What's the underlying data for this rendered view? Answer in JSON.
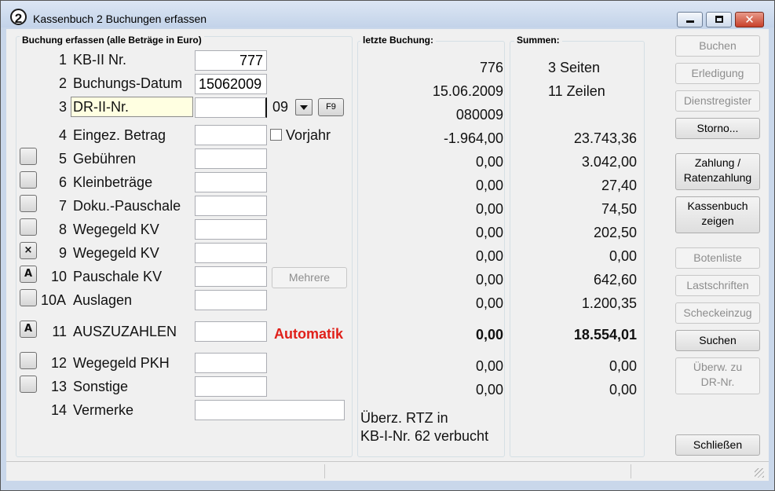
{
  "window": {
    "title": "Kassenbuch 2 Buchungen erfassen",
    "icon_text": "2"
  },
  "sections": {
    "entry": "Buchung erfassen (alle Beträge in Euro)",
    "last": "letzte Buchung:",
    "sums": "Summen:"
  },
  "rows": [
    {
      "num": "1",
      "label": "KB-II Nr.",
      "value": "777",
      "last": "776",
      "sum_text": "3 Seiten"
    },
    {
      "num": "2",
      "label": "Buchungs-Datum",
      "value": "15062009",
      "last": "15.06.2009",
      "sum_text": "11 Zeilen"
    },
    {
      "num": "3",
      "label": "DR-II-Nr.",
      "value": "",
      "suffix": "09",
      "f9": "F9",
      "last": "080009"
    },
    {
      "num": "4",
      "label": "Eingez. Betrag",
      "value": "",
      "checkbox": "Vorjahr",
      "last": "-1.964,00",
      "sum": "23.743,36"
    },
    {
      "num": "5",
      "label": "Gebühren",
      "value": "",
      "last": "0,00",
      "sum": "3.042,00"
    },
    {
      "num": "6",
      "label": "Kleinbeträge",
      "value": "",
      "last": "0,00",
      "sum": "27,40"
    },
    {
      "num": "7",
      "label": "Doku.-Pauschale",
      "value": "",
      "last": "0,00",
      "sum": "74,50"
    },
    {
      "num": "8",
      "label": "Wegegeld KV",
      "value": "",
      "last": "0,00",
      "sum": "202,50"
    },
    {
      "num": "9",
      "label": "Wegegeld KV",
      "value": "",
      "side": "×",
      "last": "0,00",
      "sum": "0,00"
    },
    {
      "num": "10",
      "label": "Pauschale KV",
      "value": "",
      "side": "A",
      "mehrere": "Mehrere",
      "last": "0,00",
      "sum": "642,60"
    },
    {
      "num": "10A",
      "label": "Auslagen",
      "value": "",
      "last": "0,00",
      "sum": "1.200,35"
    },
    {
      "num": "11",
      "label": "AUSZUZAHLEN",
      "value": "",
      "side": "A",
      "auto": "Automatik",
      "last": "0,00",
      "sum": "18.554,01"
    },
    {
      "num": "12",
      "label": "Wegegeld PKH",
      "value": "",
      "last": "0,00",
      "sum": "0,00"
    },
    {
      "num": "13",
      "label": "Sonstige",
      "value": "",
      "last": "0,00",
      "sum": "0,00"
    },
    {
      "num": "14",
      "label": "Vermerke",
      "value": ""
    }
  ],
  "note_lines": [
    "Überz. RTZ in",
    "KB-I-Nr. 62 verbucht"
  ],
  "buttons": {
    "buchen": "Buchen",
    "erledigung": "Erledigung",
    "dienstregister": "Dienstregister",
    "storno": "Storno...",
    "zahlung_1": "Zahlung /",
    "zahlung_2": "Ratenzahlung",
    "kassenbuch_1": "Kassenbuch",
    "kassenbuch_2": "zeigen",
    "botenliste": "Botenliste",
    "lastschriften": "Lastschriften",
    "scheckeinzug": "Scheckeinzug",
    "suchen": "Suchen",
    "ueberw_1": "Überw. zu",
    "ueberw_2": "DR-Nr.",
    "schliessen": "Schließen"
  },
  "colors": {
    "automatik": "#e0201a",
    "focus_field": "#ffffe1",
    "title_bar": "#c9d7ea"
  }
}
